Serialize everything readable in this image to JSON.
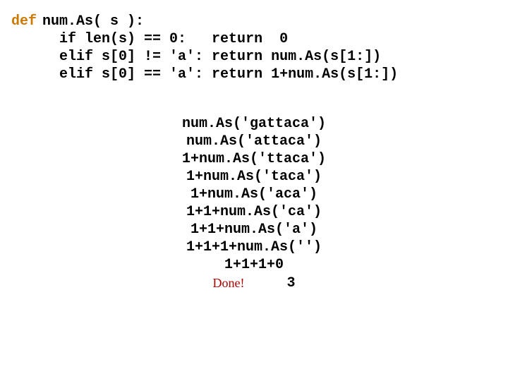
{
  "code": {
    "def_kw": "def",
    "body": "num.As( s ):\n  if len(s) == 0:   return  0\n  elif s[0] != 'a': return num.As(s[1:])\n  elif s[0] == 'a': return 1+num.As(s[1:])"
  },
  "trace": {
    "lines": [
      "num.As('gattaca')",
      "num.As('attaca')",
      "1+num.As('ttaca')",
      "1+num.As('taca')",
      "1+num.As('aca')",
      "1+1+num.As('ca')",
      "1+1+num.As('a')",
      "1+1+1+num.As('')",
      "1+1+1+0"
    ],
    "done_label": "Done!",
    "result": "3"
  }
}
